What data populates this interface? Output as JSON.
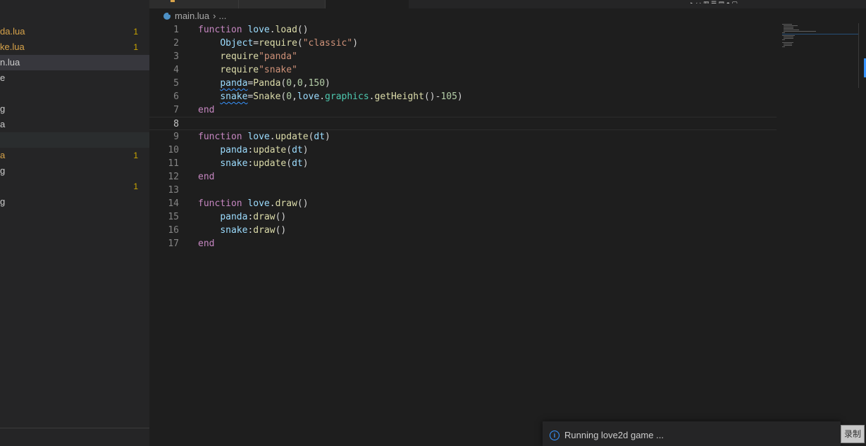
{
  "sidebar": {
    "items": [
      {
        "label": "da.lua",
        "badge": "1",
        "status": "modified"
      },
      {
        "label": "ke.lua",
        "badge": "1",
        "status": "modified"
      },
      {
        "label": "n.lua",
        "badge": "",
        "status": "selected"
      },
      {
        "label": "e",
        "badge": "",
        "status": "normal"
      },
      {
        "label": "",
        "badge": "",
        "status": "normal"
      },
      {
        "label": "g",
        "badge": "",
        "status": "normal"
      },
      {
        "label": "a",
        "badge": "",
        "status": "normal"
      },
      {
        "label": "",
        "badge": "",
        "status": "highlight"
      },
      {
        "label": "a",
        "badge": "1",
        "status": "modified"
      },
      {
        "label": "g",
        "badge": "",
        "status": "normal"
      },
      {
        "label": "",
        "badge": "1",
        "status": "normal"
      },
      {
        "label": "g",
        "badge": "",
        "status": "normal"
      }
    ]
  },
  "breadcrumb": {
    "file": "main.lua",
    "more": "..."
  },
  "editor": {
    "current_line": 8,
    "lines": [
      {
        "n": "1",
        "tokens": [
          [
            "kw",
            "function "
          ],
          [
            "var",
            "love"
          ],
          [
            "op",
            "."
          ],
          [
            "fn",
            "load"
          ],
          [
            "op",
            "()"
          ]
        ]
      },
      {
        "n": "2",
        "tokens": [
          [
            "op",
            "    "
          ],
          [
            "var",
            "Object"
          ],
          [
            "op",
            "="
          ],
          [
            "fn",
            "require"
          ],
          [
            "op",
            "("
          ],
          [
            "str",
            "\"classic\""
          ],
          [
            "op",
            ")"
          ]
        ]
      },
      {
        "n": "3",
        "tokens": [
          [
            "op",
            "    "
          ],
          [
            "fn",
            "require"
          ],
          [
            "str",
            "\"panda\""
          ]
        ]
      },
      {
        "n": "4",
        "tokens": [
          [
            "op",
            "    "
          ],
          [
            "fn",
            "require"
          ],
          [
            "str",
            "\"snake\""
          ]
        ]
      },
      {
        "n": "5",
        "tokens": [
          [
            "op",
            "    "
          ],
          [
            "var squig",
            "panda"
          ],
          [
            "op",
            "="
          ],
          [
            "fn",
            "Panda"
          ],
          [
            "op",
            "("
          ],
          [
            "num",
            "0"
          ],
          [
            "op",
            ","
          ],
          [
            "num",
            "0"
          ],
          [
            "op",
            ","
          ],
          [
            "num",
            "150"
          ],
          [
            "op",
            ")"
          ]
        ]
      },
      {
        "n": "6",
        "tokens": [
          [
            "op",
            "    "
          ],
          [
            "var squig",
            "snake"
          ],
          [
            "op",
            "="
          ],
          [
            "fn",
            "Snake"
          ],
          [
            "op",
            "("
          ],
          [
            "num",
            "0"
          ],
          [
            "op",
            ","
          ],
          [
            "var",
            "love"
          ],
          [
            "op",
            "."
          ],
          [
            "fld",
            "graphics"
          ],
          [
            "op",
            "."
          ],
          [
            "fn",
            "getHeight"
          ],
          [
            "op",
            "()-"
          ],
          [
            "num",
            "105"
          ],
          [
            "op",
            ")"
          ]
        ]
      },
      {
        "n": "7",
        "tokens": [
          [
            "kw",
            "end"
          ]
        ]
      },
      {
        "n": "8",
        "tokens": []
      },
      {
        "n": "9",
        "tokens": [
          [
            "kw",
            "function "
          ],
          [
            "var",
            "love"
          ],
          [
            "op",
            "."
          ],
          [
            "fn",
            "update"
          ],
          [
            "op",
            "("
          ],
          [
            "var",
            "dt"
          ],
          [
            "op",
            ")"
          ]
        ]
      },
      {
        "n": "10",
        "tokens": [
          [
            "op",
            "    "
          ],
          [
            "var",
            "panda"
          ],
          [
            "op",
            ":"
          ],
          [
            "fn",
            "update"
          ],
          [
            "op",
            "("
          ],
          [
            "var",
            "dt"
          ],
          [
            "op",
            ")"
          ]
        ]
      },
      {
        "n": "11",
        "tokens": [
          [
            "op",
            "    "
          ],
          [
            "var",
            "snake"
          ],
          [
            "op",
            ":"
          ],
          [
            "fn",
            "update"
          ],
          [
            "op",
            "("
          ],
          [
            "var",
            "dt"
          ],
          [
            "op",
            ")"
          ]
        ]
      },
      {
        "n": "12",
        "tokens": [
          [
            "kw",
            "end"
          ]
        ]
      },
      {
        "n": "13",
        "tokens": []
      },
      {
        "n": "14",
        "tokens": [
          [
            "kw",
            "function "
          ],
          [
            "var",
            "love"
          ],
          [
            "op",
            "."
          ],
          [
            "fn",
            "draw"
          ],
          [
            "op",
            "()"
          ]
        ]
      },
      {
        "n": "15",
        "tokens": [
          [
            "op",
            "    "
          ],
          [
            "var",
            "panda"
          ],
          [
            "op",
            ":"
          ],
          [
            "fn",
            "draw"
          ],
          [
            "op",
            "()"
          ]
        ]
      },
      {
        "n": "16",
        "tokens": [
          [
            "op",
            "    "
          ],
          [
            "var",
            "snake"
          ],
          [
            "op",
            ":"
          ],
          [
            "fn",
            "draw"
          ],
          [
            "op",
            "()"
          ]
        ]
      },
      {
        "n": "17",
        "tokens": [
          [
            "kw",
            "end"
          ]
        ]
      }
    ]
  },
  "notification": {
    "icon": "info-icon",
    "message": "Running love2d game ..."
  },
  "record_button": {
    "label": "录制"
  },
  "colors": {
    "accent": "#3794ff",
    "modified": "#d7a34a",
    "keyword": "#c586c0",
    "function": "#dcdcaa",
    "variable": "#9cdcfe",
    "string": "#ce9178",
    "number": "#b5cea8"
  }
}
